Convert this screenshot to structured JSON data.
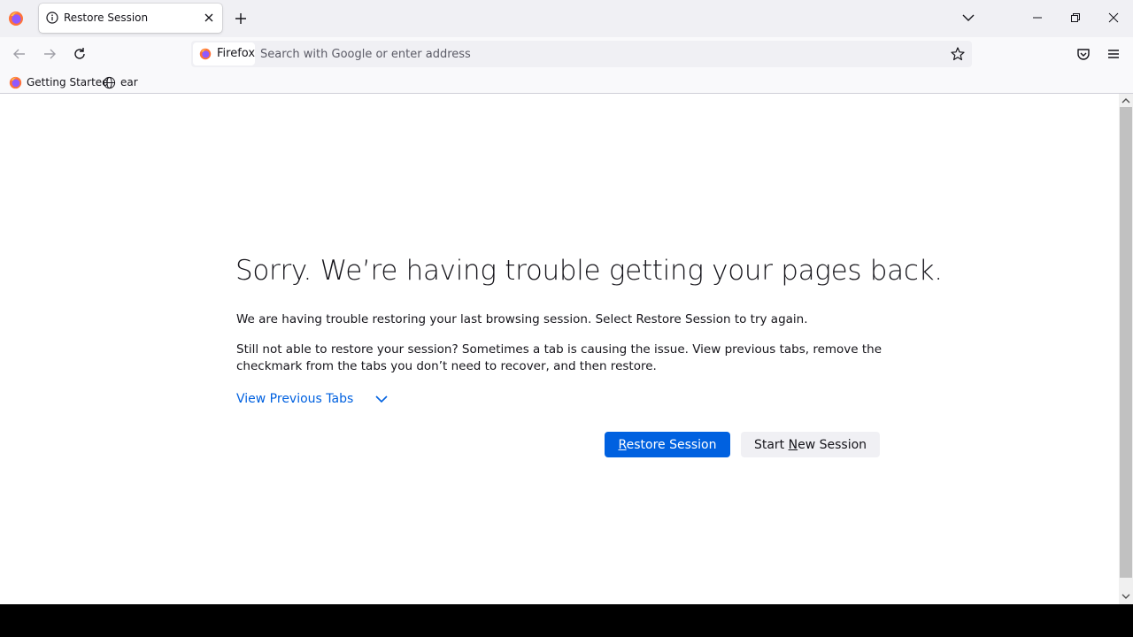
{
  "browser": {
    "name": "Firefox",
    "tab": {
      "title": "Restore Session"
    },
    "address_bar": {
      "identity_label": "Firefox",
      "placeholder": "Search with Google or enter address",
      "value": ""
    },
    "bookmarks": [
      {
        "label": "Getting Started",
        "icon": "firefox-icon"
      },
      {
        "label": "ear",
        "icon": "globe-icon"
      }
    ],
    "icons": {
      "tab": "info-icon",
      "close": "close-icon",
      "new_tab": "plus-icon",
      "tab_list": "chevron-down-icon",
      "back": "back-arrow-icon",
      "forward": "forward-arrow-icon",
      "reload": "reload-icon",
      "bookmark": "star-icon",
      "pocket": "pocket-icon",
      "menu": "hamburger-menu-icon",
      "minimize": "minimize-icon",
      "maximize": "restore-window-icon",
      "window_close": "close-icon"
    }
  },
  "page": {
    "title": "Sorry. We’re having trouble getting your pages back.",
    "paragraph1": "We are having trouble restoring your last browsing session. Select Restore Session to try again.",
    "paragraph2": "Still not able to restore your session? Sometimes a tab is causing the issue. View previous tabs, remove the checkmark from the tabs you don’t need to recover, and then restore.",
    "view_previous_tabs": "View Previous Tabs",
    "restore_button": {
      "accesskey": "R",
      "rest": "estore Session"
    },
    "new_session_button": {
      "before": "Start ",
      "accesskey": "N",
      "after": "ew Session"
    }
  },
  "colors": {
    "primary_button": "#0061e0",
    "link": "#0061e0",
    "secondary_button": "#f0f0f4",
    "toolbar": "#f9f9fb",
    "tabstrip": "#f0f0f4"
  }
}
